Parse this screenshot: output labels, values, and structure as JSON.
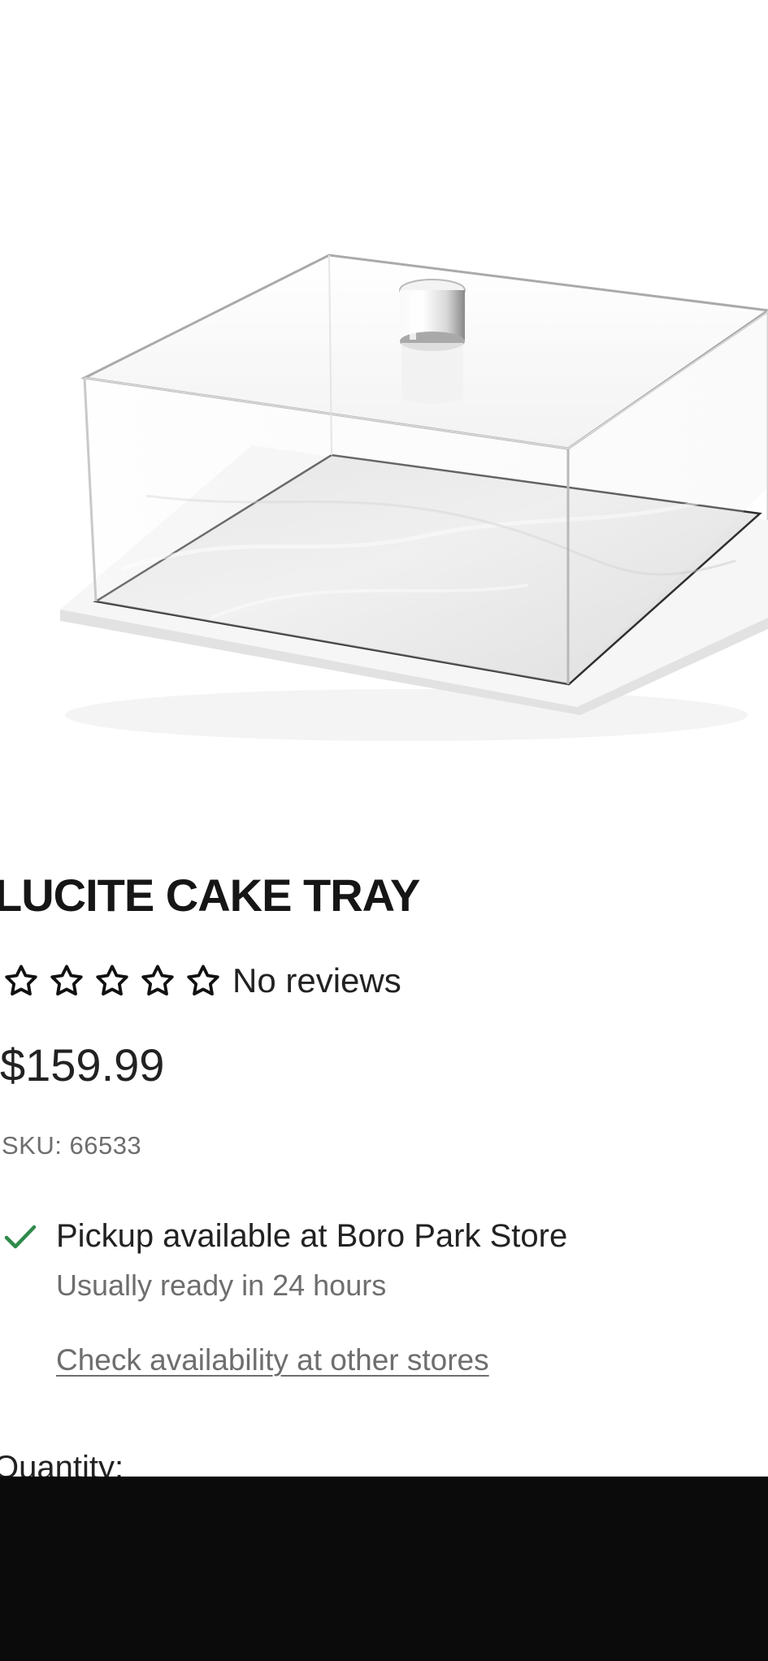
{
  "product": {
    "image_alt": "Lucite cake tray with clear dome cover and marble base",
    "title": "LUCITE CAKE TRAY",
    "rating": {
      "value": 0,
      "max": 5,
      "review_text": "No reviews"
    },
    "price": "$159.99",
    "sku": "SKU: 66533"
  },
  "pickup": {
    "title": "Pickup available at Boro Park Store",
    "subtitle": "Usually ready in 24 hours",
    "link": "Check availability at other stores"
  },
  "quantity": {
    "label": "Quantity:"
  },
  "colors": {
    "check": "#2f8a4b",
    "price": "#222222",
    "muted": "#6e6e6e",
    "overlay": "#0b0b0c"
  },
  "icons": {
    "rating": "star-outline-icon",
    "pickup": "check-icon"
  }
}
